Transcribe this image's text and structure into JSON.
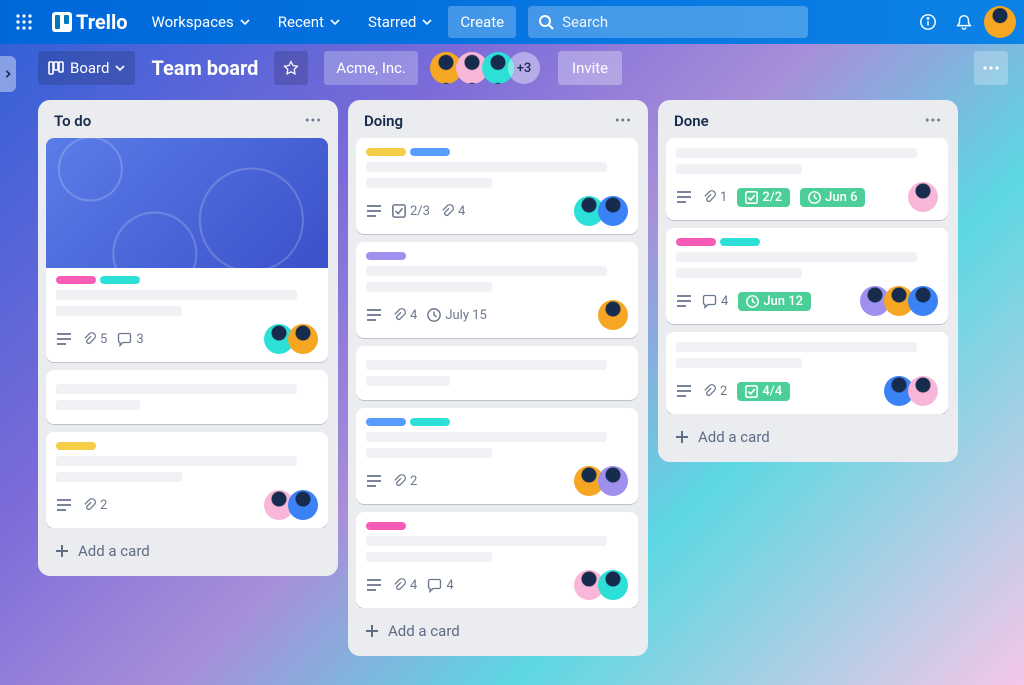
{
  "header": {
    "brand": "Trello",
    "workspaces": "Workspaces",
    "recent": "Recent",
    "starred": "Starred",
    "create": "Create",
    "search_placeholder": "Search"
  },
  "board_bar": {
    "view": "Board",
    "title": "Team board",
    "org": "Acme, Inc.",
    "extra_members": "+3",
    "invite": "Invite"
  },
  "lists": [
    {
      "title": "To do",
      "add": "Add a card",
      "cards": [
        {
          "cover": true,
          "labels": [
            "pink",
            "cyan"
          ],
          "badges": {
            "attachments": "5",
            "comments": "3"
          },
          "avatars": [
            "teal",
            "yellow"
          ]
        },
        {
          "gap": true
        },
        {
          "labels": [
            "yellow"
          ],
          "badges": {
            "attachments": "2"
          },
          "avatars": [
            "pink",
            "blue"
          ]
        }
      ]
    },
    {
      "title": "Doing",
      "add": "Add a card",
      "cards": [
        {
          "labels": [
            "yellow",
            "blue"
          ],
          "badges": {
            "checklist": "2/3",
            "attachments": "4"
          },
          "avatars": [
            "teal",
            "blue"
          ]
        },
        {
          "labels": [
            "purple"
          ],
          "badges": {
            "attachments": "4",
            "due": "July 15"
          },
          "avatars": [
            "yellow"
          ]
        },
        {
          "gap": true
        },
        {
          "labels": [
            "blue",
            "cyan"
          ],
          "badges": {
            "attachments": "2"
          },
          "avatars": [
            "yellow",
            "purple"
          ]
        },
        {
          "labels": [
            "pink"
          ],
          "badges": {
            "attachments": "4",
            "comments": "4"
          },
          "avatars": [
            "pink",
            "teal"
          ]
        }
      ]
    },
    {
      "title": "Done",
      "add": "Add a card",
      "cards": [
        {
          "labels": [],
          "badges": {
            "attachments": "1",
            "checklist_done": "2/2",
            "due_done": "Jun 6"
          },
          "avatars": [
            "pink"
          ]
        },
        {
          "labels": [
            "pink",
            "cyan"
          ],
          "badges": {
            "comments": "4",
            "due_done": "Jun 12"
          },
          "avatars": [
            "purple",
            "yellow",
            "blue"
          ]
        },
        {
          "labels": [],
          "badges": {
            "attachments": "2",
            "checklist_done": "4/4"
          },
          "avatars": [
            "blue",
            "pink"
          ]
        }
      ]
    }
  ]
}
